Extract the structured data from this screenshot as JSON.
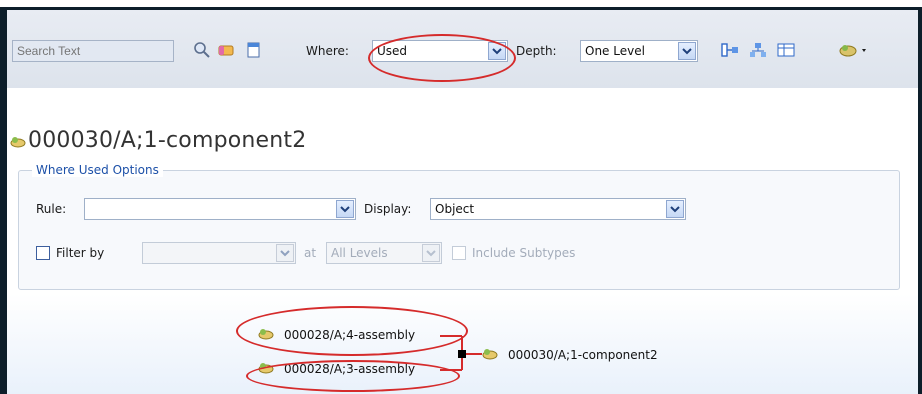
{
  "toolbar": {
    "search_placeholder": "Search Text",
    "where_label": "Where:",
    "where_value": "Used",
    "depth_label": "Depth:",
    "depth_value": "One Level"
  },
  "title": {
    "object_name": "000030/A;1-component2"
  },
  "options": {
    "group_title": "Where Used Options",
    "rule_label": "Rule:",
    "rule_value": "",
    "display_label": "Display:",
    "display_value": "Object",
    "filter_label": "Filter by",
    "filter_value": "",
    "at_label": "at",
    "levels_value": "All Levels",
    "include_subtypes_label": "Include Subtypes"
  },
  "graph": {
    "parents": [
      "000028/A;4-assembly",
      "000028/A;3-assembly"
    ],
    "child": "000030/A;1-component2"
  },
  "colors": {
    "highlight": "#d52b2b",
    "link": "#1c50a8"
  },
  "icons": {
    "search": "magnifier-icon",
    "clear": "eraser-icon",
    "new": "new-document-icon",
    "layout1": "tree-horizontal-icon",
    "layout2": "tree-vertical-icon",
    "layout3": "tree-table-icon",
    "menu": "settings-menu-icon"
  }
}
